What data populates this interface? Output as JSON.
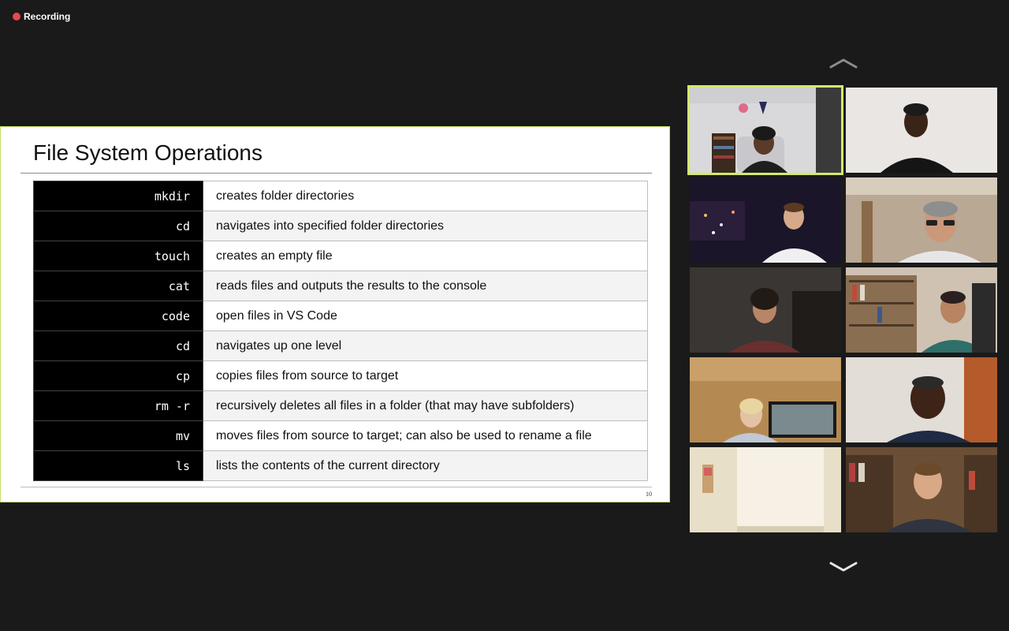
{
  "recording": {
    "label": "Recording"
  },
  "slide": {
    "title": "File System Operations",
    "page_number": "10",
    "rows": [
      {
        "cmd": "mkdir",
        "desc": "creates folder directories"
      },
      {
        "cmd": "cd",
        "desc": "navigates into specified folder directories"
      },
      {
        "cmd": "touch",
        "desc": "creates an empty file"
      },
      {
        "cmd": "cat",
        "desc": "reads files and outputs the results to the console"
      },
      {
        "cmd": "code",
        "desc": "open files in VS Code"
      },
      {
        "cmd": "cd",
        "desc": "navigates up one level"
      },
      {
        "cmd": "cp",
        "desc": "copies files from source to target"
      },
      {
        "cmd": "rm -r",
        "desc": "recursively deletes all files in a folder (that may have subfolders)"
      },
      {
        "cmd": "mv",
        "desc": "moves files from source to target; can also be used to rename a file"
      },
      {
        "cmd": "ls",
        "desc": "lists the contents of the current directory"
      }
    ]
  },
  "gallery": {
    "icons": {
      "scroll_up": "chevron-up-icon",
      "scroll_down": "chevron-down-icon"
    },
    "active_speaker_color": "#d6e86b",
    "tiles_count_visible": 10
  },
  "colors": {
    "recording_dot": "#e5484d",
    "background": "#1a1a1a",
    "slide_border": "#c3e06a"
  }
}
